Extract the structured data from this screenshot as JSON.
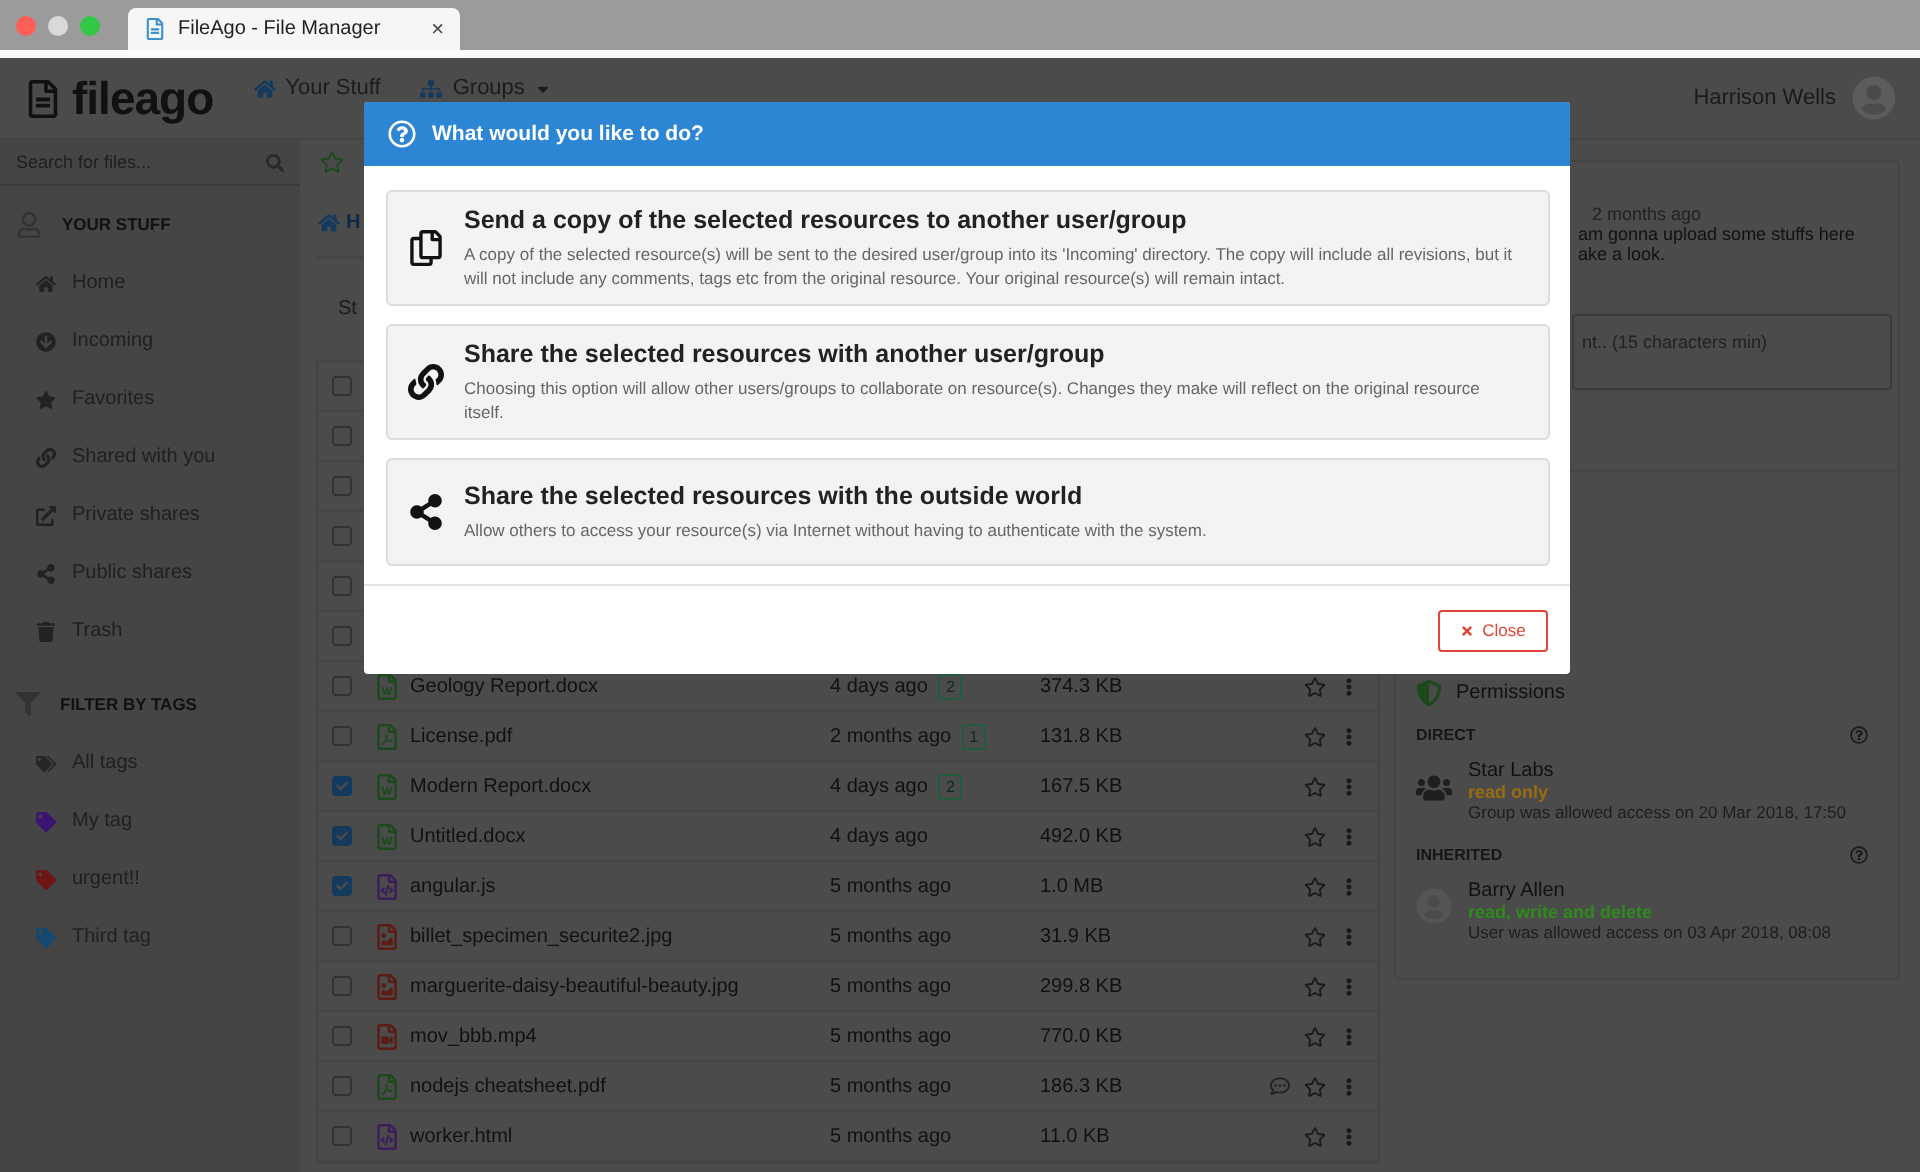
{
  "browser_tab": {
    "title": "FileAgo - File Manager",
    "close": "×"
  },
  "header": {
    "logo": "fileago",
    "nav": [
      {
        "label": "Your Stuff",
        "has_menu": false
      },
      {
        "label": "Groups",
        "has_menu": true
      }
    ],
    "user": "Harrison Wells"
  },
  "sidebar": {
    "search": {
      "placeholder": "Search for files..."
    },
    "sections": [
      {
        "title": "YOUR STUFF",
        "items": [
          "Home",
          "Incoming",
          "Favorites",
          "Shared with you",
          "Private shares",
          "Public shares",
          "Trash"
        ]
      }
    ],
    "tags_title": "FILTER BY TAGS",
    "tags": [
      {
        "label": "All tags",
        "color": "#262626"
      },
      {
        "label": "My tag",
        "color": "#3a1670"
      },
      {
        "label": "urgent!!",
        "color": "#6e1616"
      },
      {
        "label": "Third tag",
        "color": "#17486e"
      }
    ]
  },
  "main": {
    "breadcrumb": "H",
    "toolbar_tab": "St",
    "files": [
      {
        "checked": false
      },
      {
        "checked": false
      },
      {
        "checked": false
      },
      {
        "checked": false
      },
      {
        "checked": false
      },
      {
        "checked": false
      },
      {
        "checked": false,
        "kind": "word",
        "name": "Geology Report.docx",
        "modified": "4 days ago",
        "badge": "2",
        "size": "374.3 KB",
        "commented": false
      },
      {
        "checked": false,
        "kind": "pdf",
        "name": "License.pdf",
        "modified": "2 months ago",
        "badge": "1",
        "size": "131.8 KB",
        "commented": false
      },
      {
        "checked": true,
        "kind": "word",
        "name": "Modern Report.docx",
        "modified": "4 days ago",
        "badge": "2",
        "size": "167.5 KB",
        "commented": false
      },
      {
        "checked": true,
        "kind": "word",
        "name": "Untitled.docx",
        "modified": "4 days ago",
        "size": "492.0 KB",
        "commented": false
      },
      {
        "checked": true,
        "kind": "code",
        "name": "angular.js",
        "modified": "5 months ago",
        "size": "1.0 MB",
        "commented": false
      },
      {
        "checked": false,
        "kind": "image",
        "name": "billet_specimen_securite2.jpg",
        "modified": "5 months ago",
        "size": "31.9 KB",
        "commented": false
      },
      {
        "checked": false,
        "kind": "image",
        "name": "marguerite-daisy-beautiful-beauty.jpg",
        "modified": "5 months ago",
        "size": "299.8 KB",
        "commented": false
      },
      {
        "checked": false,
        "kind": "video",
        "name": "mov_bbb.mp4",
        "modified": "5 months ago",
        "size": "770.0 KB",
        "commented": false
      },
      {
        "checked": false,
        "kind": "pdf",
        "name": "nodejs cheatsheet.pdf",
        "modified": "5 months ago",
        "size": "186.3 KB",
        "commented": true
      },
      {
        "checked": false,
        "kind": "code",
        "name": "worker.html",
        "modified": "5 months ago",
        "size": "11.0 KB",
        "commented": false
      }
    ]
  },
  "details": {
    "comment": {
      "time": "2 months ago",
      "lines": [
        "am gonna upload some stuffs here",
        "ake a look."
      ]
    },
    "comment_field": {
      "placeholder": "nt.. (15 characters min)"
    },
    "permissions": {
      "title": "Permissions",
      "groups": [
        {
          "title": "DIRECT",
          "entries": [
            {
              "kind": "group",
              "name": "Star Labs",
              "access": "read only",
              "color": "#9a6c10",
              "note": "Group was allowed access on 20 Mar 2018, 17:50"
            }
          ]
        },
        {
          "title": "INHERITED",
          "entries": [
            {
              "kind": "user",
              "name": "Barry Allen",
              "access": "read, write and delete",
              "color": "#2f8a1e",
              "note": "User was allowed access on 03 Apr 2018, 08:08"
            }
          ]
        }
      ]
    }
  },
  "dialog": {
    "title": "What would you like to do?",
    "options": [
      {
        "title": "Send a copy of the selected resources to another user/group",
        "description": "A copy of the selected resource(s) will be sent to the desired user/group into its 'Incoming' directory. The copy will include all revisions, but it will not include any comments, tags etc from the original resource. Your original resource(s) will remain intact."
      },
      {
        "title": "Share the selected resources with another user/group",
        "description": "Choosing this option will allow other users/groups to collaborate on resource(s). Changes they make will reflect on the original resource itself."
      },
      {
        "title": "Share the selected resources with the outside world",
        "description": "Allow others to access your resource(s) via Internet without having to authenticate with the system."
      }
    ],
    "close": "Close"
  }
}
